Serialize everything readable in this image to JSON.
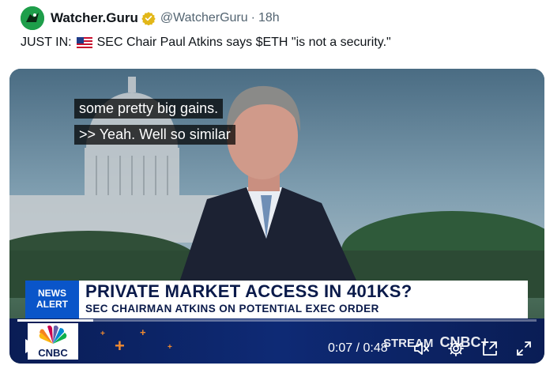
{
  "tweet": {
    "display_name": "Watcher.Guru",
    "handle": "@WatcherGuru",
    "separator": "·",
    "time": "18h",
    "text_prefix": "JUST IN:",
    "text_body": "SEC Chair Paul Atkins says $ETH \"is not a security.\""
  },
  "video": {
    "captions": [
      "some pretty big gains.",
      ">> Yeah. Well so similar"
    ],
    "news_alert_line1": "NEWS",
    "news_alert_line2": "ALERT",
    "headline": "PRIVATE MARKET ACCESS IN 401KS?",
    "subhead": "SEC CHAIRMAN ATKINS ON POTENTIAL EXEC ORDER",
    "network": "CNBC",
    "stream_brand": "STREAM",
    "stream_logo": "CNBC+",
    "time_current": "0:07",
    "time_separator": "/",
    "time_total": "0:48",
    "progress_fraction": 0.146
  },
  "icons": {
    "avatar": "watcher-guru-logo",
    "verified": "gold-verified-badge",
    "flag": "us-flag",
    "play": "play-icon",
    "mute": "volume-muted-icon",
    "settings": "gear-icon",
    "pip": "picture-in-picture-icon",
    "fullscreen": "fullscreen-icon"
  },
  "colors": {
    "news_alert_blue": "#0a55c9",
    "ticker_navy": "#0e2a75",
    "verified_gold": "#e2b719",
    "avatar_green": "#1e9e4a"
  }
}
